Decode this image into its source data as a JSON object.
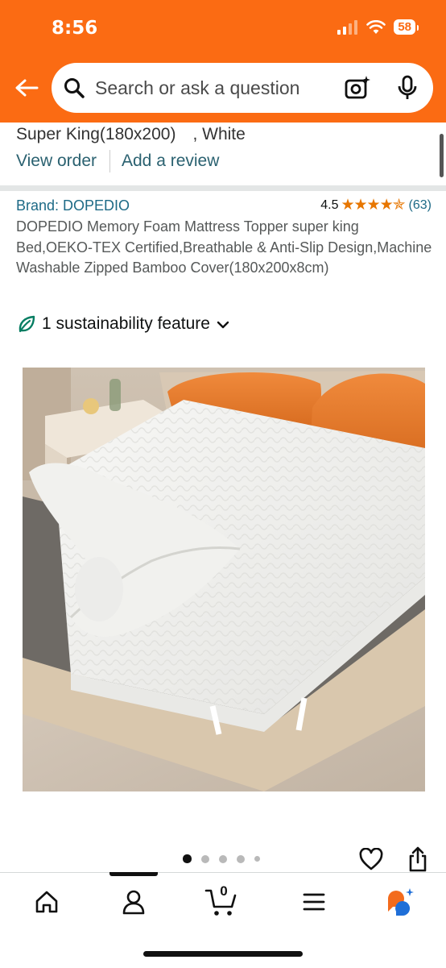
{
  "status_bar": {
    "time": "8:56",
    "battery": "58"
  },
  "search": {
    "placeholder": "Search or ask a question"
  },
  "order": {
    "variant": "Super King(180x200)　, White",
    "view_order": "View order",
    "add_review": "Add a review"
  },
  "product": {
    "brand": "Brand: DOPEDIO",
    "rating": "4.5",
    "stars": "★★★★✯",
    "rating_count": "(63)",
    "title": "DOPEDIO Memory Foam Mattress Topper super king Bed,OEKO-TEX Certified,Breathable & Anti-Slip Design,Machine Washable Zipped Bamboo Cover(180x200x8cm)",
    "sustainability": "1 sustainability feature",
    "image_count": 5,
    "active_image": 1
  },
  "nav": {
    "items": [
      "home-icon",
      "account-icon",
      "cart-icon",
      "menu-icon",
      "rufus-icon"
    ],
    "cart_count": "0"
  },
  "colors": {
    "header": "#fb6b13",
    "link": "#1d6a86",
    "star": "#e77600",
    "leaf": "#067d62"
  }
}
